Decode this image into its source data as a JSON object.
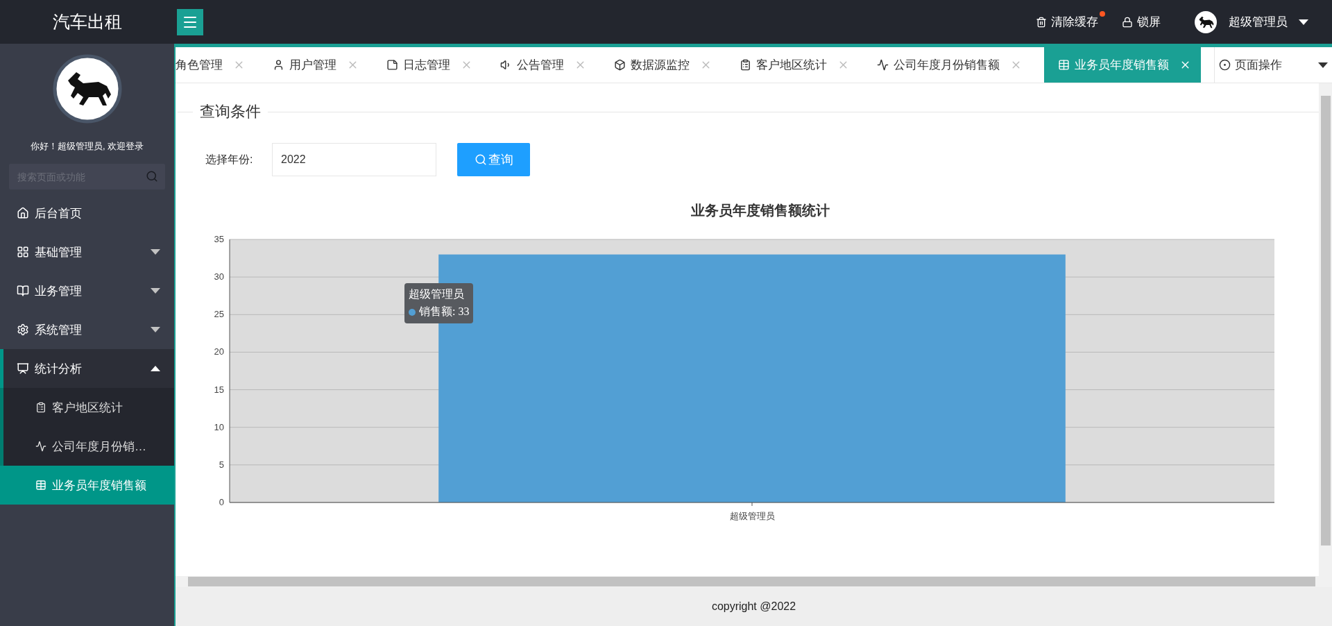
{
  "header": {
    "title": "汽车出租",
    "actions": [
      {
        "label": "清除缓存",
        "notification": true
      },
      {
        "label": "锁屏",
        "notification": false
      }
    ],
    "user": "超级管理员"
  },
  "sidebar": {
    "greeting": "你好！超级管理员, 欢迎登录",
    "search": {
      "placeholder": "搜索页面或功能"
    },
    "items": [
      {
        "label": "后台首页",
        "selected": false
      },
      {
        "label": "基础管理",
        "selected": false,
        "expanded": false
      },
      {
        "label": "业务管理",
        "selected": false,
        "expanded": false
      },
      {
        "label": "系统管理",
        "selected": false,
        "expanded": false
      },
      {
        "label": "统计分析",
        "selected": false,
        "expanded": true,
        "children": [
          {
            "label": "客户地区统计",
            "selected": false
          },
          {
            "label": "公司年度月份销…",
            "selected": false
          },
          {
            "label": "业务员年度销售额",
            "selected": true
          }
        ]
      }
    ]
  },
  "tabs": [
    {
      "label": "角色管理",
      "selected": false
    },
    {
      "label": "用户管理",
      "selected": false
    },
    {
      "label": "日志管理",
      "selected": false
    },
    {
      "label": "公告管理",
      "selected": false
    },
    {
      "label": "数据源监控",
      "selected": false
    },
    {
      "label": "客户地区统计",
      "selected": false
    },
    {
      "label": "公司年度月份销售额",
      "selected": false
    },
    {
      "label": "业务员年度销售额",
      "selected": true
    }
  ],
  "page_actions": "页面操作",
  "query": {
    "legend": "查询条件",
    "label": "选择年份:",
    "year": "2022",
    "button": "查询"
  },
  "chart": {
    "chart_data": {
      "type": "bar",
      "title": "业务员年度销售额统计",
      "categories": [
        "超级管理员"
      ],
      "series": [
        {
          "color": "#529fd4",
          "values": [
            33
          ]
        }
      ],
      "ylim": [
        0,
        35
      ],
      "yticks": [
        0,
        5,
        10,
        15,
        20,
        25,
        30,
        35
      ],
      "grid": true
    },
    "tooltip": {
      "title": "超级管理员",
      "text": "销售额: 33"
    }
  },
  "footer": "copyright @2022"
}
